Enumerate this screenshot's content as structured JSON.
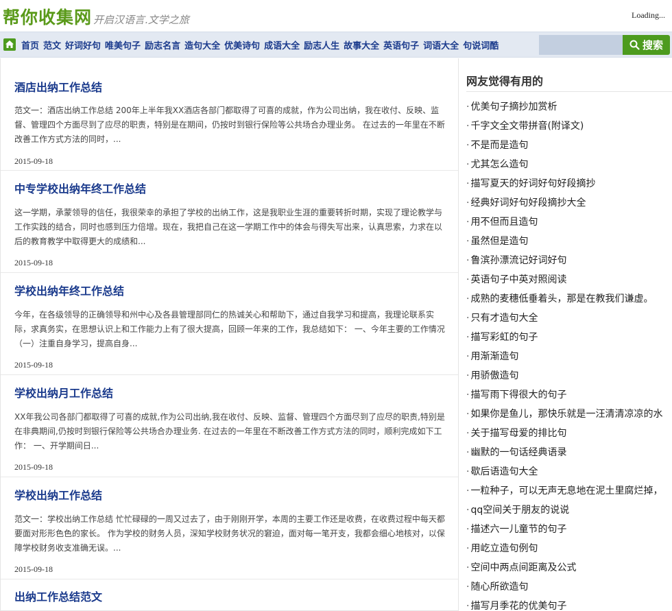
{
  "header": {
    "logo_main": "帮你收集网",
    "logo_sub": "开启汉语言.文学之旅",
    "loading_text": "Loading..."
  },
  "nav": {
    "items": [
      "首页",
      "范文",
      "好词好句",
      "唯美句子",
      "励志名言",
      "造句大全",
      "优美诗句",
      "成语大全",
      "励志人生",
      "故事大全",
      "英语句子",
      "词语大全",
      "句说词酷"
    ],
    "search_placeholder": "",
    "search_label": "搜索"
  },
  "articles": [
    {
      "title": "酒店出纳工作总结",
      "summary": "范文一：酒店出纳工作总结  200年上半年我XX酒店各部门都取得了可喜的成就，作为公司出纳，我在收付、反映、监督、管理四个方面尽到了应尽的职责，特别是在期间，仍按时到银行保险等公共场合办理业务。  在过去的一年里在不断改善工作方式方法的同时，...",
      "date": "2015-09-18"
    },
    {
      "title": "中专学校出纳年终工作总结",
      "summary": "这一学期，承蒙领导的信任，我很荣幸的承担了学校的出纳工作，这是我职业生涯的重要转折时期，实现了理论教学与工作实践的结合，同时也感到压力倍增。现在，我把自己在这一学期工作中的体会与得失写出来，认真思索，力求在以后的教育教学中取得更大的成绩和...",
      "date": "2015-09-18"
    },
    {
      "title": "学校出纳年终工作总结",
      "summary": "今年，在各级领导的正确领导和州中心及各县管理部同仁的热诚关心和帮助下，通过自我学习和提高，我理论联系实际，求真务实，在思想认识上和工作能力上有了很大提高，回顾一年来的工作，我总结如下：  一、今年主要的工作情况  （一）注重自身学习，提高自身...",
      "date": "2015-09-18"
    },
    {
      "title": "学校出纳月工作总结",
      "summary": "XX年我公司各部门都取得了可喜的成就,作为公司出纳,我在收付、反映、监督、管理四个方面尽到了应尽的职责,特别是在非典期间,仍按时到银行保险等公共场合办理业务. 在过去的一年里在不断改善工作方式方法的同时，顺利完成如下工作：  一、开学期间日...",
      "date": "2015-09-18"
    },
    {
      "title": "学校出纳工作总结",
      "summary": "范文一：学校出纳工作总结  忙忙碌碌的一周又过去了，由于刚刚开学，本周的主要工作还是收费，在收费过程中每天都要面对形形色色的家长。  作为学校的财务人员，深知学校财务状况的窘迫，面对每一笔开支，我都会细心地核对，以保障学校财务收支准确无误。...",
      "date": "2015-09-18"
    },
    {
      "title": "出纳工作总结范文",
      "summary": "",
      "date": ""
    }
  ],
  "sidebar": {
    "title": "网友觉得有用的",
    "items": [
      "优美句子摘抄加赏析",
      "千字文全文带拼音(附译文)",
      "不是而是造句",
      "尤其怎么造句",
      "描写夏天的好词好句好段摘抄",
      "经典好词好句好段摘抄大全",
      "用不但而且造句",
      "虽然但是造句",
      "鲁滨孙漂流记好词好句",
      "英语句子中英对照阅读",
      "成熟的麦穗低垂着头，那是在教我们谦虚。",
      "只有才造句大全",
      "描写彩虹的句子",
      "用渐渐造句",
      "用骄傲造句",
      "描写雨下得很大的句子",
      "如果你是鱼儿，那快乐就是一汪清清凉凉的水",
      "关于描写母爱的排比句",
      "幽默的一句话经典语录",
      "歇后语造句大全",
      "一粒种子，可以无声无息地在泥土里腐烂掉，",
      "qq空间关于朋友的说说",
      "描述六一儿童节的句子",
      "用屹立造句例句",
      "空间中两点间距离及公式",
      "随心所欲造句",
      "描写月季花的优美句子"
    ]
  },
  "colors": {
    "accent_green": "#4d9b1e",
    "link_blue": "#1a3a8c",
    "nav_bg": "#e3e9f2"
  }
}
